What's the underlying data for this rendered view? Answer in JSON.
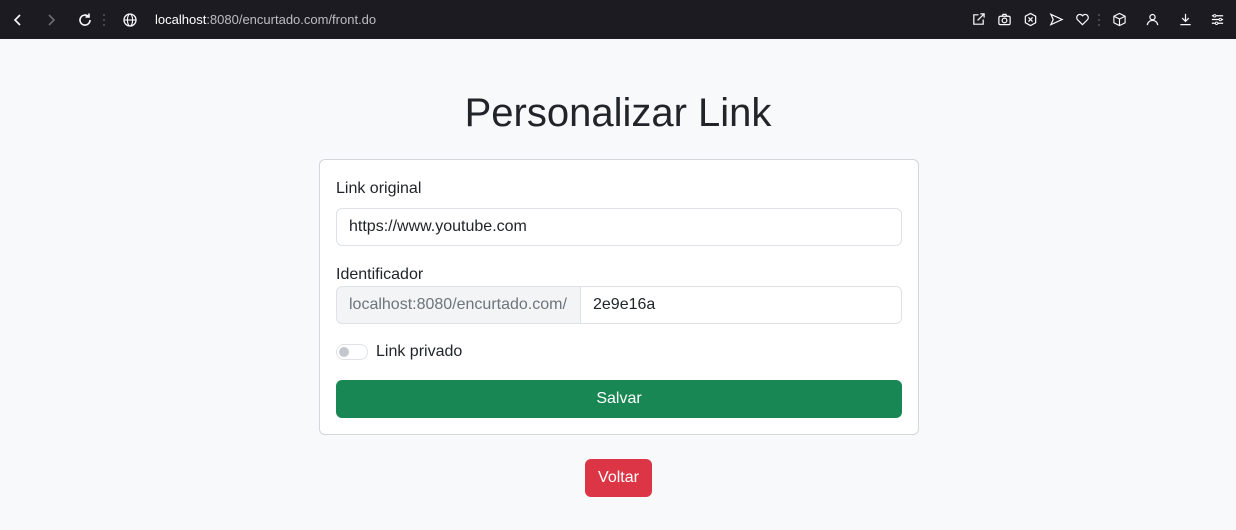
{
  "browser": {
    "url_host": "localhost",
    "url_rest": ":8080/encurtado.com/front.do",
    "icons": [
      "back-icon",
      "forward-icon",
      "reload-icon",
      "globe-icon",
      "share-icon",
      "screenshot-icon",
      "block-icon",
      "send-icon",
      "heart-icon",
      "box-icon",
      "profile-icon",
      "download-icon",
      "menu-icon"
    ]
  },
  "page": {
    "title": "Personalizar Link",
    "form": {
      "original_label": "Link original",
      "original_value": "https://www.youtube.com",
      "identifier_label": "Identificador",
      "identifier_prefix": "localhost:8080/encurtado.com/",
      "identifier_value": "2e9e16a",
      "private_label": "Link privado",
      "private_checked": false,
      "save_label": "Salvar"
    },
    "back_label": "Voltar"
  },
  "colors": {
    "save": "#198754",
    "back": "#dc3545",
    "browser_bar": "#1c1b22"
  }
}
